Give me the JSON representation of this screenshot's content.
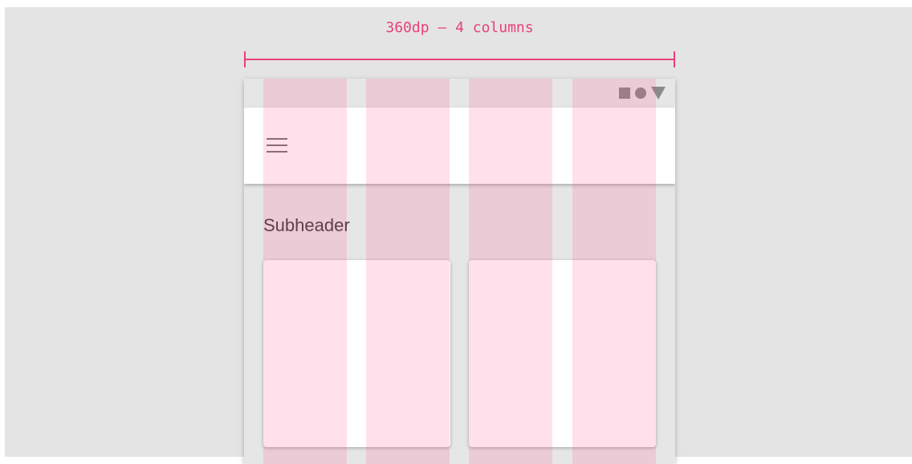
{
  "dimension": {
    "label": "360dp – 4 columns"
  },
  "colors": {
    "accent": "#e9407a",
    "column_overlay": "rgba(255,64,129,0.16)",
    "background": "#e4e4e4"
  },
  "phone": {
    "status_icons": [
      "square-icon",
      "circle-icon",
      "triangle-icon"
    ],
    "app_bar": {
      "menu_icon": "hamburger-menu-icon"
    },
    "subheader": "Subheader",
    "cards": [
      "card-1",
      "card-2"
    ],
    "columns": 4
  }
}
